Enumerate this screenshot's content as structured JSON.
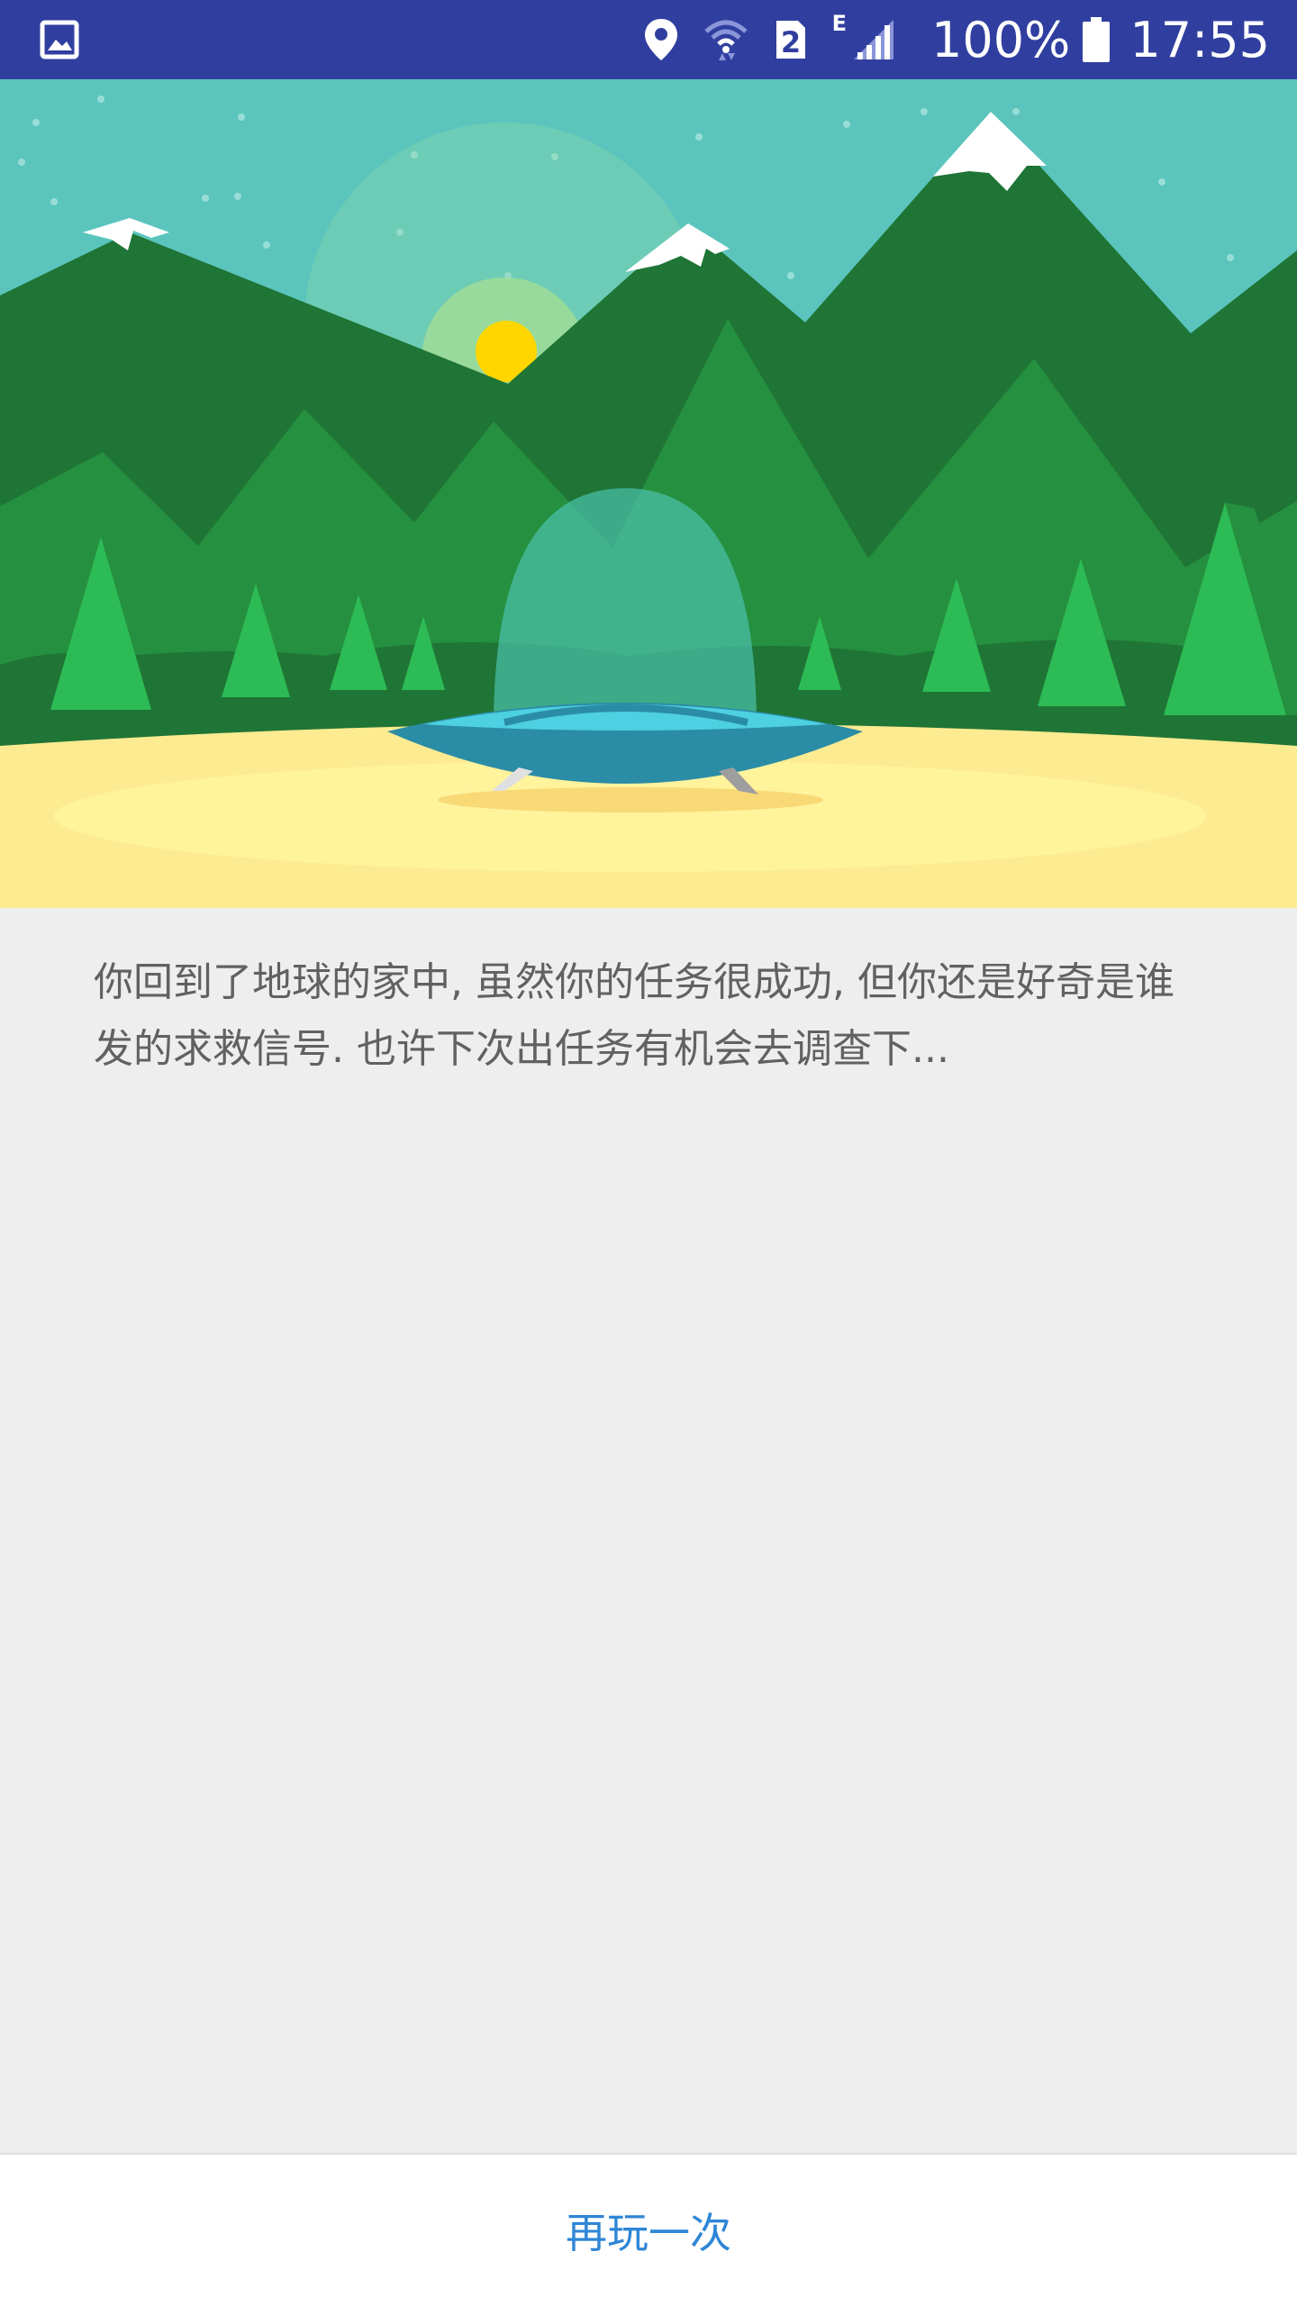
{
  "status_bar": {
    "left_icon": "image-icon",
    "icons": [
      "location-icon",
      "wifi-icon",
      "sim-2-icon",
      "signal-icon",
      "battery-icon"
    ],
    "sim_slot": "2",
    "network_type": "E",
    "battery": "100%",
    "time": "17:55"
  },
  "hero": {
    "scene": "ufo-landing-illustration",
    "colors": {
      "sky": "#5bc5bd",
      "sun": "#ffd600",
      "mountain_dark": "#1f7535",
      "mountain_mid": "#25903f",
      "tree": "#2dbb55",
      "sand": "#fdeb91",
      "ufo": "#2b8ca6",
      "ufo_dome": "#4fc6b6"
    }
  },
  "message": {
    "text": "你回到了地球的家中, 虽然你的任务很成功, 但你还是好奇是谁发的求救信号. 也许下次出任务有机会去调查下..."
  },
  "actions": {
    "play_again_label": "再玩一次",
    "accent": "#2e86d6"
  }
}
